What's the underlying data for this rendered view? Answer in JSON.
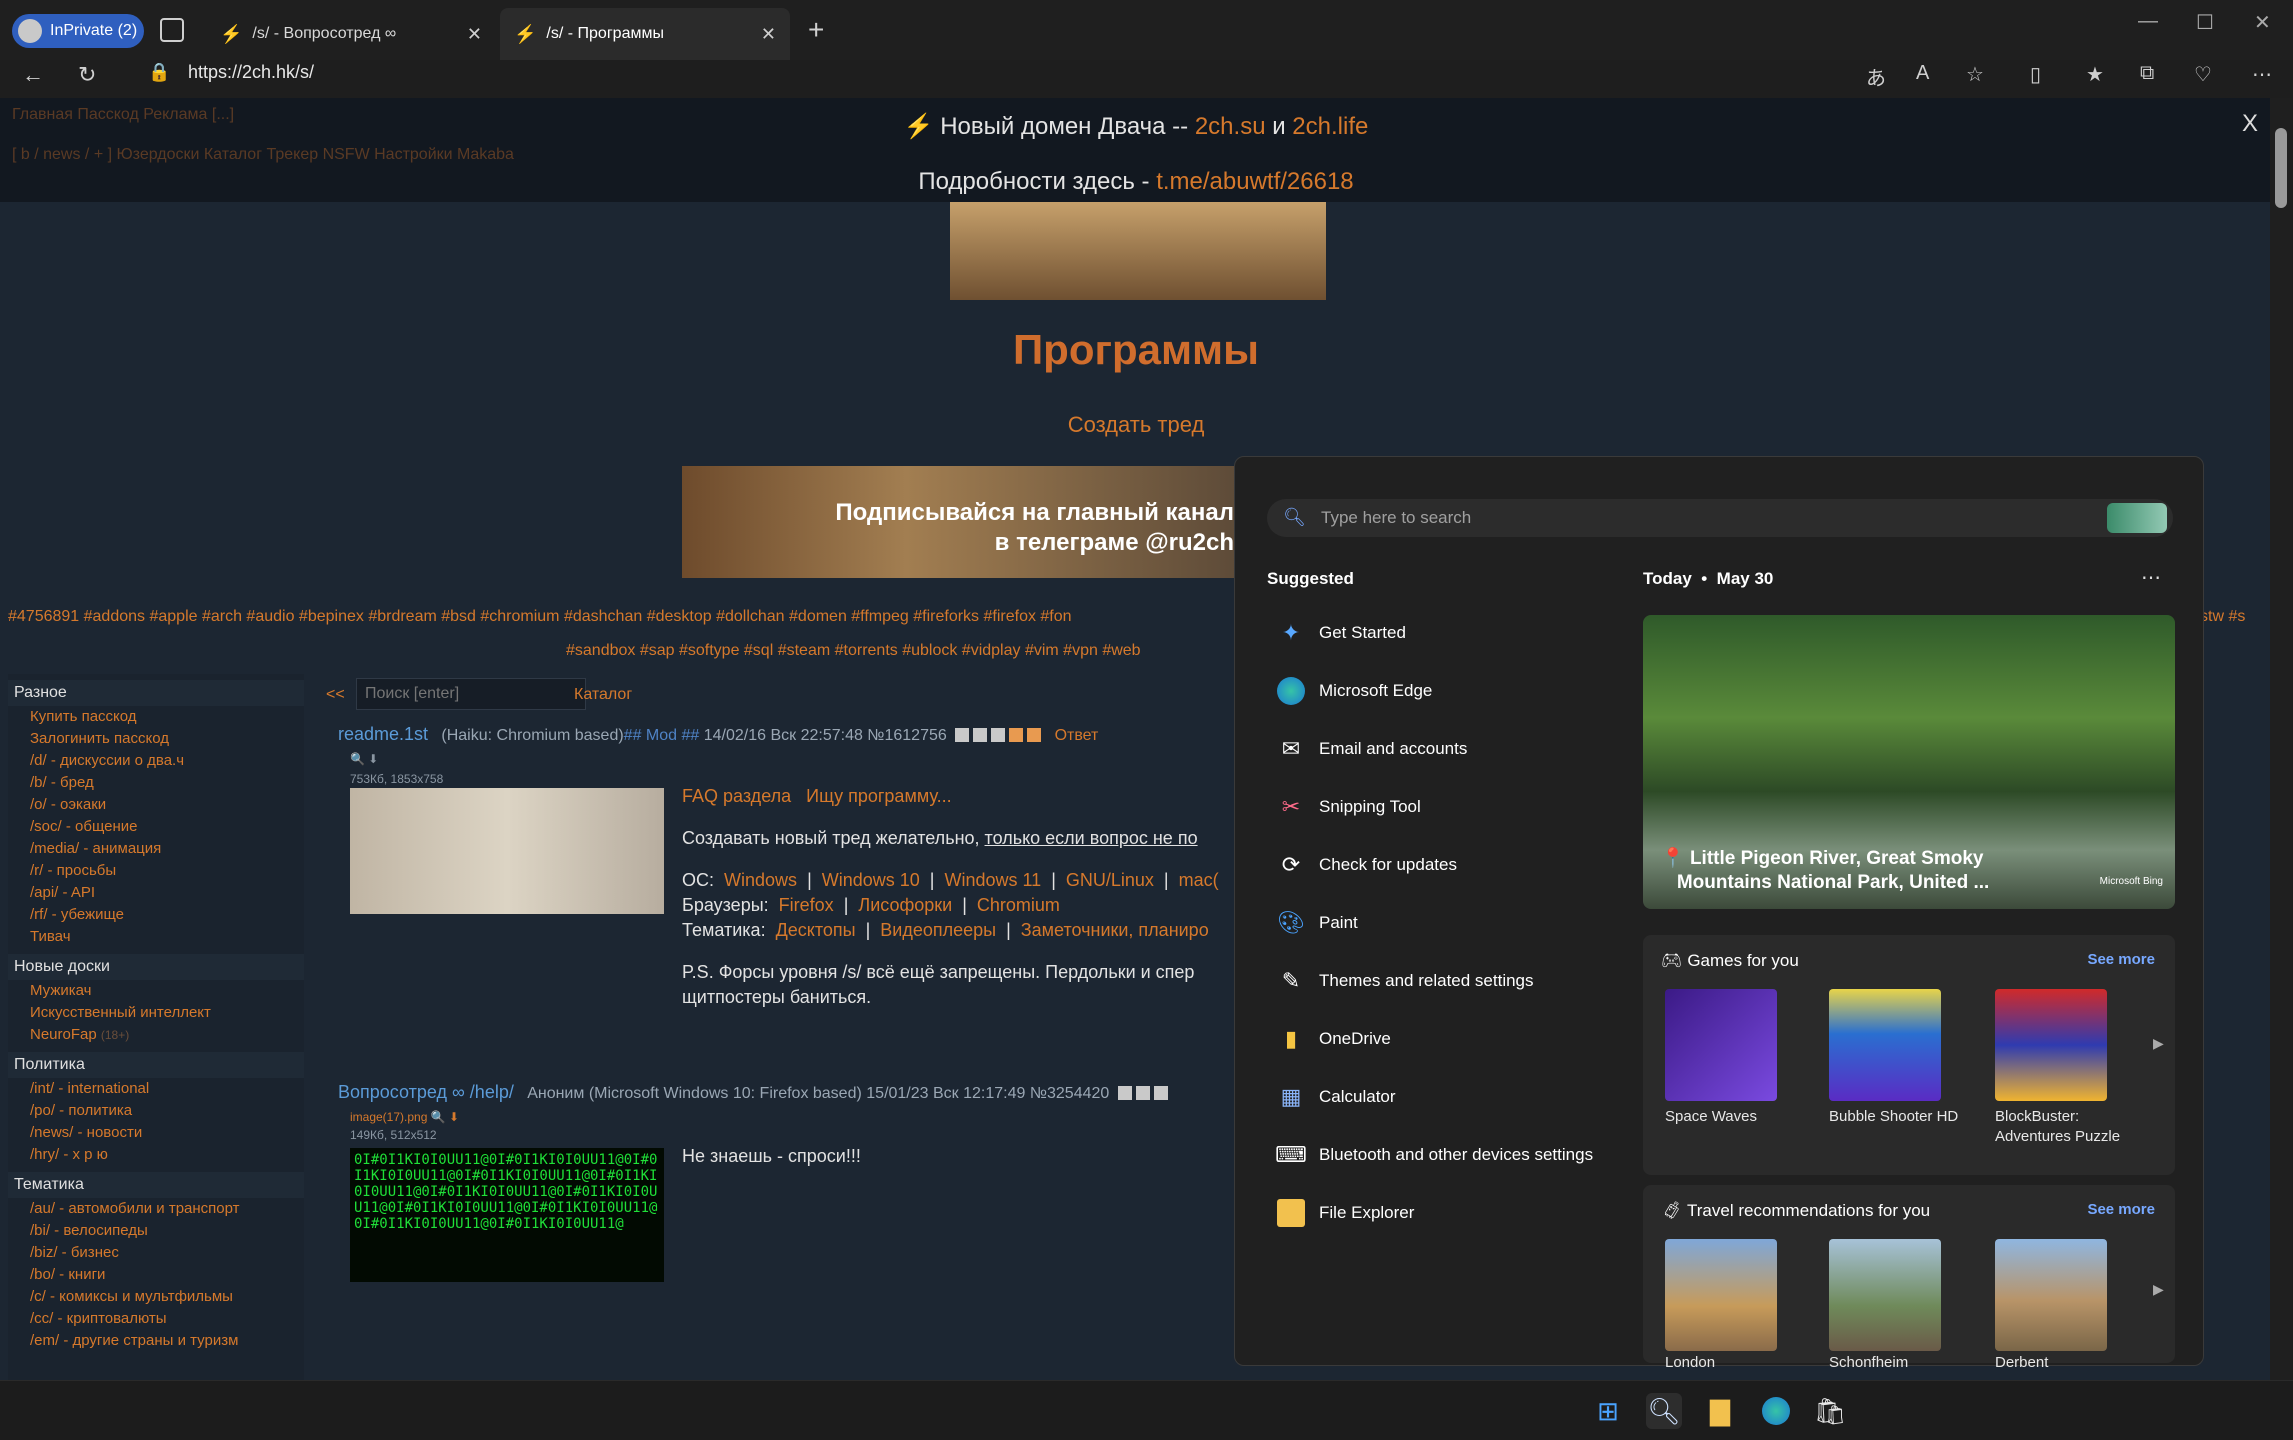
{
  "browser": {
    "profile_label": "InPrivate (2)",
    "tabs": [
      {
        "title": "/s/ - Вопросотред ∞"
      },
      {
        "title": "/s/ - Программы"
      }
    ],
    "url": "https://2ch.hk/s/"
  },
  "notice": {
    "line1_prefix": "Новый домен Двача -- ",
    "domain1": "2ch.su",
    "and": " и ",
    "domain2": "2ch.life",
    "line2_prefix": "Подробности здесь - ",
    "link": "t.me/abuwtf/26618",
    "close": "X"
  },
  "topnav": {
    "row1": "Главная   Пасскод   Реклама   [...]",
    "row2": "[ b / news / + ]  Юзердоски  Каталог  Трекер  NSFW  Настройки  Makaba"
  },
  "board": {
    "title": "Программы",
    "create_thread": "Создать тред",
    "banner_text_1": "Подписывайся на главный канал",
    "banner_text_2": "в телеграме @ru2ch"
  },
  "tags_row1": "#4756891  #addons  #apple  #arch  #audio  #bepinex  #brdream  #bsd  #chromium  #dashchan  #desktop  #dollchan  #domen  #ffmpeg  #fireforks  #firefox  #fon",
  "tags_row1_right": "stw  #s",
  "tags_row2": "#sandbox  #sap  #softype  #sql  #steam  #torrents  #ublock  #vidplay  #vim  #vpn  #web",
  "sidebar": [
    {
      "head": "Разное",
      "items": [
        "Купить пасскод",
        "Залогинить пасскод",
        "/d/ - дискуссии о два.ч",
        "/b/ - бред",
        "/o/ - оэкаки",
        "/soc/ - общение",
        "/media/ - анимация",
        "/r/ - просьбы",
        "/api/ - API",
        "/rf/ - убежище",
        "Тивач"
      ]
    },
    {
      "head": "Новые доски",
      "items": [
        "Мужикач",
        "Искусственный интеллект",
        "NeuroFap"
      ],
      "note": "(18+)"
    },
    {
      "head": "Политика",
      "items": [
        "/int/ - international",
        "/po/ - политика",
        "/news/ - новости",
        "/hry/ - х р ю"
      ]
    },
    {
      "head": "Тематика",
      "items": [
        "/au/ - автомобили и транспорт",
        "/bi/ - велосипеды",
        "/biz/ - бизнес",
        "/bo/ - книги",
        "/c/ - комиксы и мультфильмы",
        "/cc/ - криптовалюты",
        "/em/ - другие страны и туризм"
      ]
    }
  ],
  "search": {
    "chev": "<<",
    "placeholder": "Поиск [enter]",
    "catalog": "Каталог"
  },
  "post1": {
    "subject": "readme.1st",
    "meta": "(Haiku: Chromium based)",
    "mod": "## Mod ##",
    "date": "14/02/16 Вск 22:57:48 №1612756",
    "reply": "Ответ",
    "fileinfo": "753Кб, 1853x758",
    "links": [
      "FAQ раздела",
      "Ищу программу..."
    ],
    "text1_prefix": "Создавать новый тред желательно, ",
    "text1_u": "только если вопрос не по",
    "os_label": "ОС:",
    "os": [
      "Windows",
      "Windows 10",
      "Windows 11",
      "GNU/Linux",
      "mac("
    ],
    "br_label": "Браузеры:",
    "browsers": [
      "Firefox",
      "Лисофорки",
      "Chromium"
    ],
    "th_label": "Тематика:",
    "themes": [
      "Десктопы",
      "Видеоплееры",
      "Заметочники, планиро"
    ],
    "ps1": "P.S. Форсы уровня /s/ всё ещё запрещены. Пердольки и спер",
    "ps2": "щитпостеры баниться."
  },
  "post2": {
    "subject": "Вопросотред ∞ /help/",
    "name": "Аноним",
    "meta": "(Microsoft Windows 10: Firefox based)",
    "date": "15/01/23 Вск 12:17:49 №3254420",
    "file": "image(17).png",
    "fileinfo": "149Кб, 512x512",
    "text": "Не знаешь - спроси!!!"
  },
  "flyout": {
    "search_placeholder": "Type here to search",
    "suggested_label": "Suggested",
    "suggested": [
      {
        "label": "Get Started",
        "icon": "get-started-icon"
      },
      {
        "label": "Microsoft Edge",
        "icon": "edge-icon"
      },
      {
        "label": "Email and accounts",
        "icon": "mail-icon"
      },
      {
        "label": "Snipping Tool",
        "icon": "snipping-icon"
      },
      {
        "label": "Check for updates",
        "icon": "update-icon"
      },
      {
        "label": "Paint",
        "icon": "paint-icon"
      },
      {
        "label": "Themes and related settings",
        "icon": "brush-icon"
      },
      {
        "label": "OneDrive",
        "icon": "onedrive-icon"
      },
      {
        "label": "Calculator",
        "icon": "calculator-icon"
      },
      {
        "label": "Bluetooth and other devices settings",
        "icon": "bluetooth-devices-icon"
      },
      {
        "label": "File Explorer",
        "icon": "folder-icon"
      }
    ],
    "today": "Today",
    "date": "May 30",
    "hero_caption_1": "Little Pigeon River, Great Smoky",
    "hero_caption_2": "Mountains National Park, United ...",
    "hero_badge": "Microsoft Bing",
    "games_title": "Games for you",
    "see_more": "See more",
    "games": [
      {
        "label": "Space Waves",
        "color": "#5b2ba8"
      },
      {
        "label": "Bubble Shooter HD",
        "color": "#2a6fd0"
      },
      {
        "label": "BlockBuster: Adventures Puzzle",
        "color": "#2f3bb0"
      }
    ],
    "travel_title": "Travel recommendations for you",
    "travel": [
      {
        "label": "London"
      },
      {
        "label": "Schonfheim"
      },
      {
        "label": "Derbent"
      }
    ]
  }
}
